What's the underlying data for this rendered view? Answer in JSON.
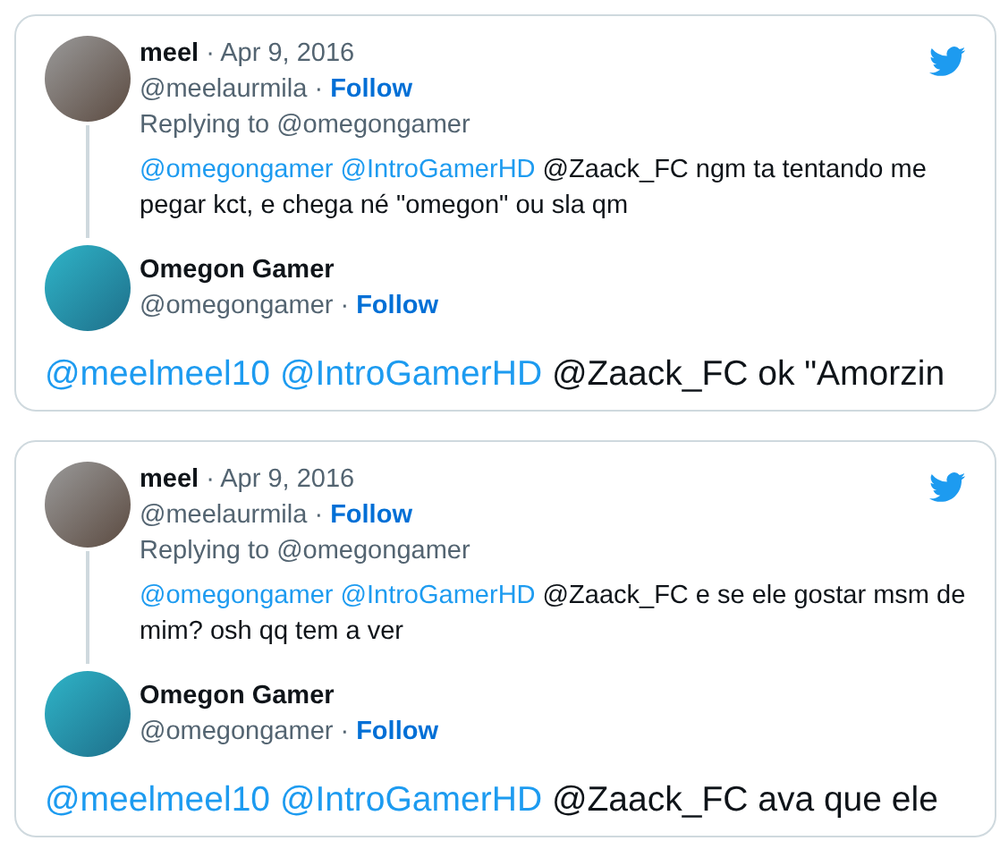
{
  "tweets": [
    {
      "parent": {
        "name": "meel",
        "date": "· Apr 9, 2016",
        "handle": "@meelaurmila ·",
        "follow": "Follow",
        "replying_to": "Replying to @omegongamer",
        "text": [
          {
            "kind": "mention",
            "text": "@omegongamer"
          },
          {
            "kind": "mention",
            "text": "@IntroGamerHD"
          },
          {
            "kind": "text",
            "text": "@Zaack_FC ngm ta tentando me pegar kct, e chega né \"omegon\" ou sla qm"
          }
        ]
      },
      "reply": {
        "name": "Omegon Gamer",
        "handle": "@omegongamer ·",
        "follow": "Follow",
        "text": [
          {
            "kind": "mention",
            "text": "@meelmeel10"
          },
          {
            "kind": "mention",
            "text": "@IntroGamerHD"
          },
          {
            "kind": "text",
            "text": "@Zaack_FC ok \"Amorzin"
          }
        ]
      }
    },
    {
      "parent": {
        "name": "meel",
        "date": "· Apr 9, 2016",
        "handle": "@meelaurmila ·",
        "follow": "Follow",
        "replying_to": "Replying to @omegongamer",
        "text": [
          {
            "kind": "mention",
            "text": "@omegongamer"
          },
          {
            "kind": "mention",
            "text": "@IntroGamerHD"
          },
          {
            "kind": "text",
            "text": "@Zaack_FC e se ele gostar msm de mim? osh qq tem a ver"
          }
        ]
      },
      "reply": {
        "name": "Omegon Gamer",
        "handle": "@omegongamer ·",
        "follow": "Follow",
        "text": [
          {
            "kind": "mention",
            "text": "@meelmeel10"
          },
          {
            "kind": "mention",
            "text": "@IntroGamerHD"
          },
          {
            "kind": "text",
            "text": "@Zaack_FC ava que ele"
          }
        ]
      }
    }
  ]
}
